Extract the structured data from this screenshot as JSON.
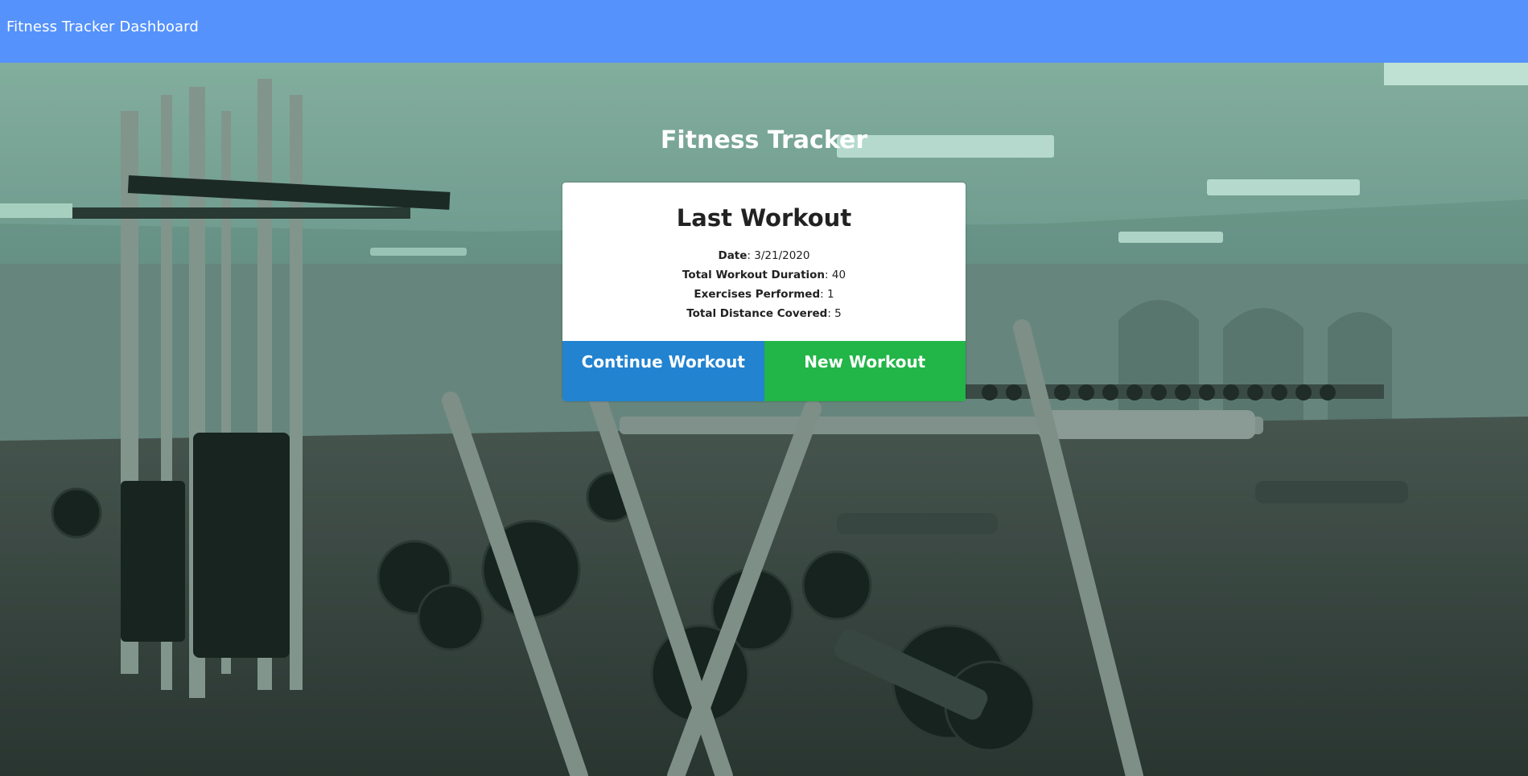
{
  "navbar": {
    "brand": "Fitness Tracker Dashboard",
    "color": "#5592fb"
  },
  "hero": {
    "title": "Fitness Tracker",
    "background": "gym-photo-green-tint"
  },
  "last_workout": {
    "title": "Last Workout",
    "stats": [
      {
        "label": "Date",
        "value": "3/21/2020"
      },
      {
        "label": "Total Workout Duration",
        "value": "40"
      },
      {
        "label": "Exercises Performed",
        "value": "1"
      },
      {
        "label": "Total Distance Covered",
        "value": "5"
      }
    ]
  },
  "actions": {
    "continue_label": "Continue Workout",
    "continue_color": "#2283d0",
    "new_label": "New Workout",
    "new_color": "#22b547"
  }
}
